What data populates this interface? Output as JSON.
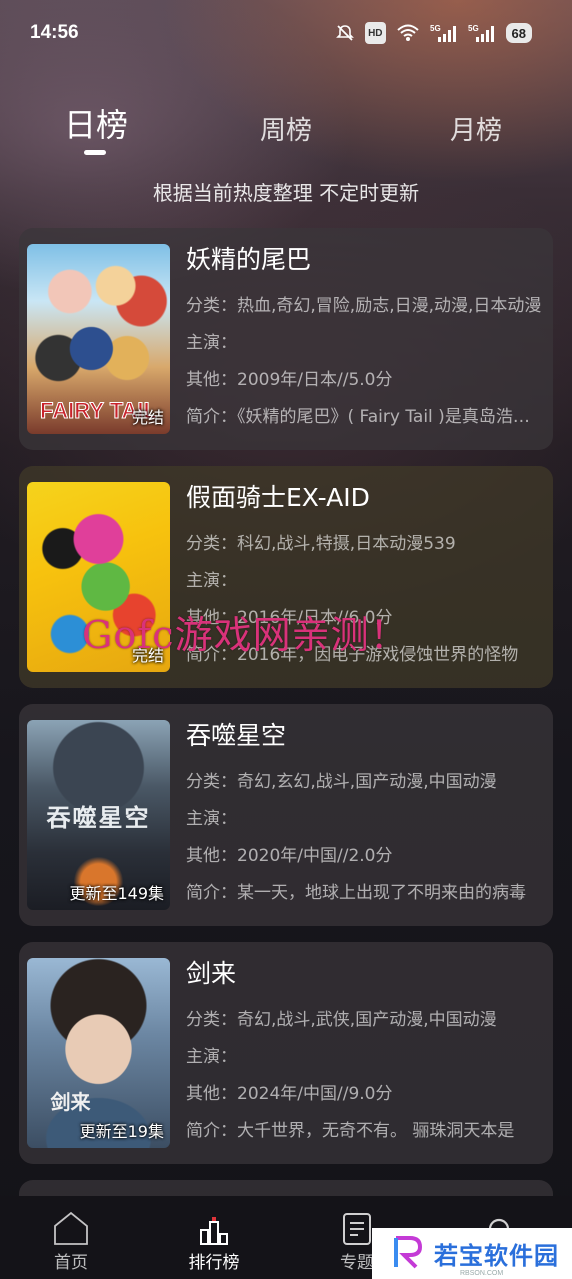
{
  "status_bar": {
    "time": "14:56",
    "hd_label": "HD",
    "battery": "68",
    "icons": [
      "mute-icon",
      "hd-icon",
      "wifi-icon",
      "5g-signal-icon",
      "5g-signal-icon"
    ]
  },
  "tabs": [
    {
      "label": "日榜",
      "active": true
    },
    {
      "label": "周榜",
      "active": false
    },
    {
      "label": "月榜",
      "active": false
    }
  ],
  "subtitle": "根据当前热度整理 不定时更新",
  "items": [
    {
      "title": "妖精的尾巴",
      "category": "分类：热血,奇幻,冒险,励志,日漫,动漫,日本动漫",
      "cast": "主演：",
      "other": "其他：2009年/日本//5.0分",
      "intro": "简介：《妖精的尾巴》( Fairy Tail )是真岛浩创作的漫画",
      "badge": "完结",
      "cover_logo": "FAIRY TAIL"
    },
    {
      "title": "假面骑士EX-AID",
      "category": "分类：科幻,战斗,特摄,日本动漫539",
      "cast": "主演：",
      "other": "其他：2016年/日本//6.0分",
      "intro": "简介：2016年，因电子游戏侵蚀世界的怪物",
      "badge": "完结",
      "cover_logo": ""
    },
    {
      "title": "吞噬星空",
      "category": "分类：奇幻,玄幻,战斗,国产动漫,中国动漫",
      "cast": "主演：",
      "other": "其他：2020年/中国//2.0分",
      "intro": "简介：某一天，地球上出现了不明来由的病毒",
      "badge": "更新至149集",
      "cover_logo": "吞噬星空"
    },
    {
      "title": "剑来",
      "category": "分类：奇幻,战斗,武侠,国产动漫,中国动漫",
      "cast": "主演：",
      "other": "其他：2024年/中国//9.0分",
      "intro": "简介：大千世界，无奇不有。 骊珠洞天本是",
      "badge": "更新至19集",
      "cover_logo": "剑来"
    }
  ],
  "watermark": "Gofc游戏网亲测！",
  "bottom_nav": [
    {
      "label": "首页",
      "icon": "home-icon",
      "active": false
    },
    {
      "label": "排行榜",
      "icon": "ranking-icon",
      "active": true
    },
    {
      "label": "专题",
      "icon": "topic-icon",
      "active": false
    },
    {
      "label": "",
      "icon": "search-icon",
      "active": false
    }
  ],
  "logo_overlay": {
    "text": "若宝软件园",
    "sub": "RBSON.COM"
  }
}
